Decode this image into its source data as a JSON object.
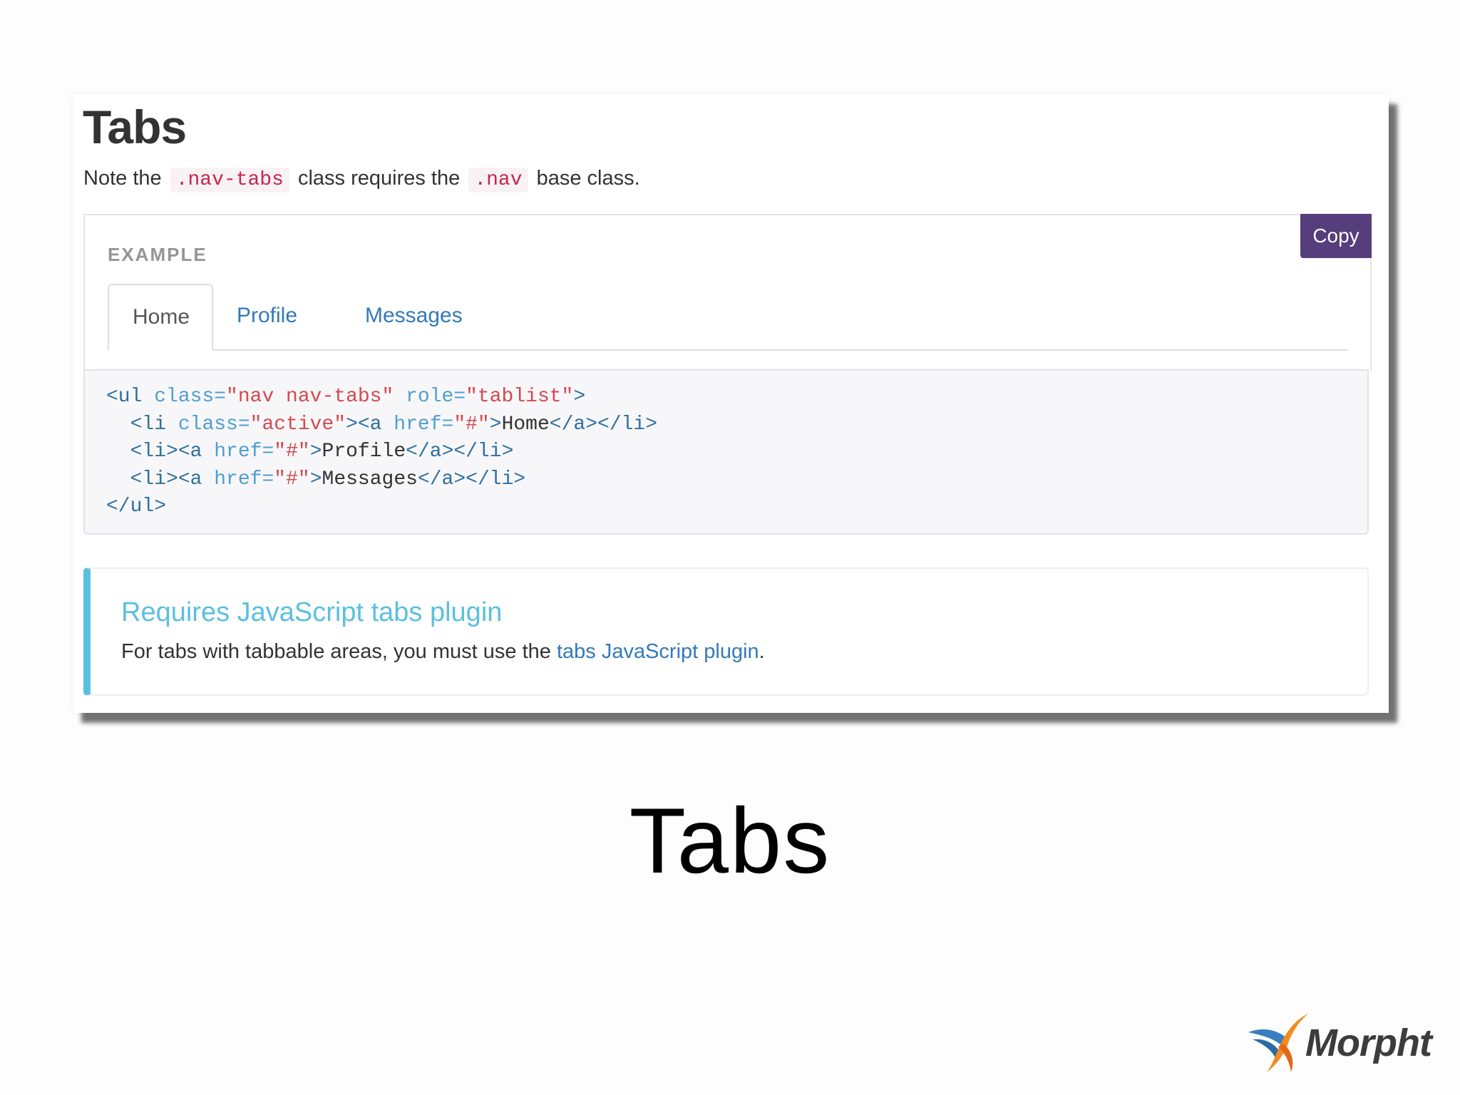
{
  "doc": {
    "title": "Tabs",
    "intro": {
      "prefix": "Note the ",
      "code1": ".nav-tabs",
      "middle": " class requires the ",
      "code2": ".nav",
      "suffix": " base class."
    },
    "example": {
      "label": "EXAMPLE",
      "copy_label": "Copy",
      "tabs": [
        {
          "label": "Home",
          "active": true
        },
        {
          "label": "Profile",
          "active": false
        },
        {
          "label": "Messages",
          "active": false
        }
      ]
    },
    "code_lines": [
      "<ul class=\"nav nav-tabs\" role=\"tablist\">",
      "  <li class=\"active\"><a href=\"#\">Home</a></li>",
      "  <li><a href=\"#\">Profile</a></li>",
      "  <li><a href=\"#\">Messages</a></li>",
      "</ul>"
    ],
    "callout": {
      "title": "Requires JavaScript tabs plugin",
      "text_prefix": "For tabs with tabbable areas, you must use the ",
      "link": "tabs JavaScript plugin",
      "text_suffix": "."
    }
  },
  "slide": {
    "title": "Tabs",
    "logo_text": "Morpht"
  },
  "colors": {
    "accent": "#563d7c",
    "link": "#337ab7",
    "info": "#5bc0de",
    "code_pink": "#c7254e"
  }
}
